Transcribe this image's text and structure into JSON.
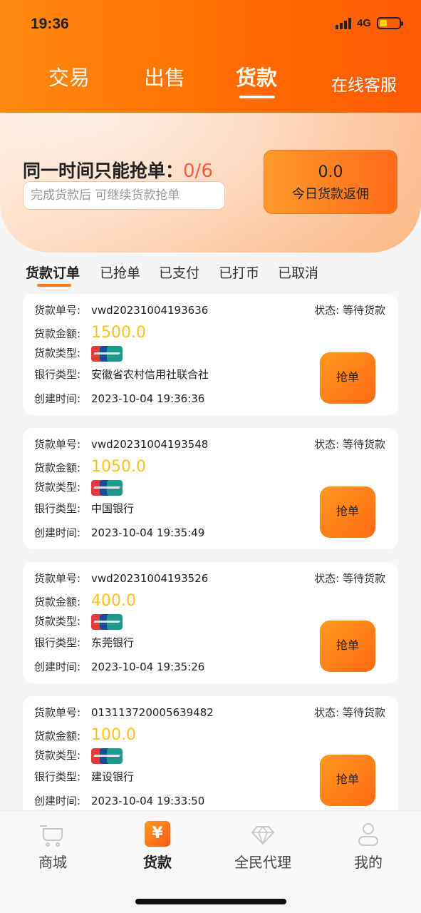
{
  "status_bar": {
    "time": "19:36",
    "network": "4G"
  },
  "nav": {
    "tabs": [
      {
        "label": "交易"
      },
      {
        "label": "出售"
      },
      {
        "label": "货款"
      }
    ],
    "service_label": "在线客服"
  },
  "hero": {
    "limit_label": "同一时间只能抢单：",
    "limit_count": "0/6",
    "hint": "完成货款后 可继续货款抢单",
    "rebate_value": "0.0",
    "rebate_label": "今日货款返佣"
  },
  "subtabs": [
    "货款订单",
    "已抢单",
    "已支付",
    "已打币",
    "已取消"
  ],
  "labels": {
    "order_no": "货款单号:",
    "amount": "货款金额:",
    "type": "货款类型:",
    "bank": "银行类型:",
    "created": "创建时间:"
  },
  "orders": [
    {
      "order_no": "vwd20231004193636",
      "status": "状态: 等待货款",
      "amount": "1500.0",
      "bank": "安徽省农村信用社联合社",
      "created": "2023-10-04 19:36:36",
      "button": "抢单"
    },
    {
      "order_no": "vwd20231004193548",
      "status": "状态: 等待货款",
      "amount": "1050.0",
      "bank": "中国银行",
      "created": "2023-10-04 19:35:49",
      "button": "抢单"
    },
    {
      "order_no": "vwd20231004193526",
      "status": "状态: 等待货款",
      "amount": "400.0",
      "bank": "东莞银行",
      "created": "2023-10-04 19:35:26",
      "button": "抢单"
    },
    {
      "order_no": "013113720005639482",
      "status": "状态: 等待货款",
      "amount": "100.0",
      "bank": "建设银行",
      "created": "2023-10-04 19:33:50",
      "button": "抢单"
    }
  ],
  "tabbar": [
    {
      "label": "商城",
      "icon": "cart-icon"
    },
    {
      "label": "货款",
      "icon": "yen-icon"
    },
    {
      "label": "全民代理",
      "icon": "diamond-icon"
    },
    {
      "label": "我的",
      "icon": "user-icon"
    }
  ],
  "colors": {
    "accent": "#ff6a00",
    "amount": "#ffc21a",
    "limit": "#ff5b3d"
  }
}
